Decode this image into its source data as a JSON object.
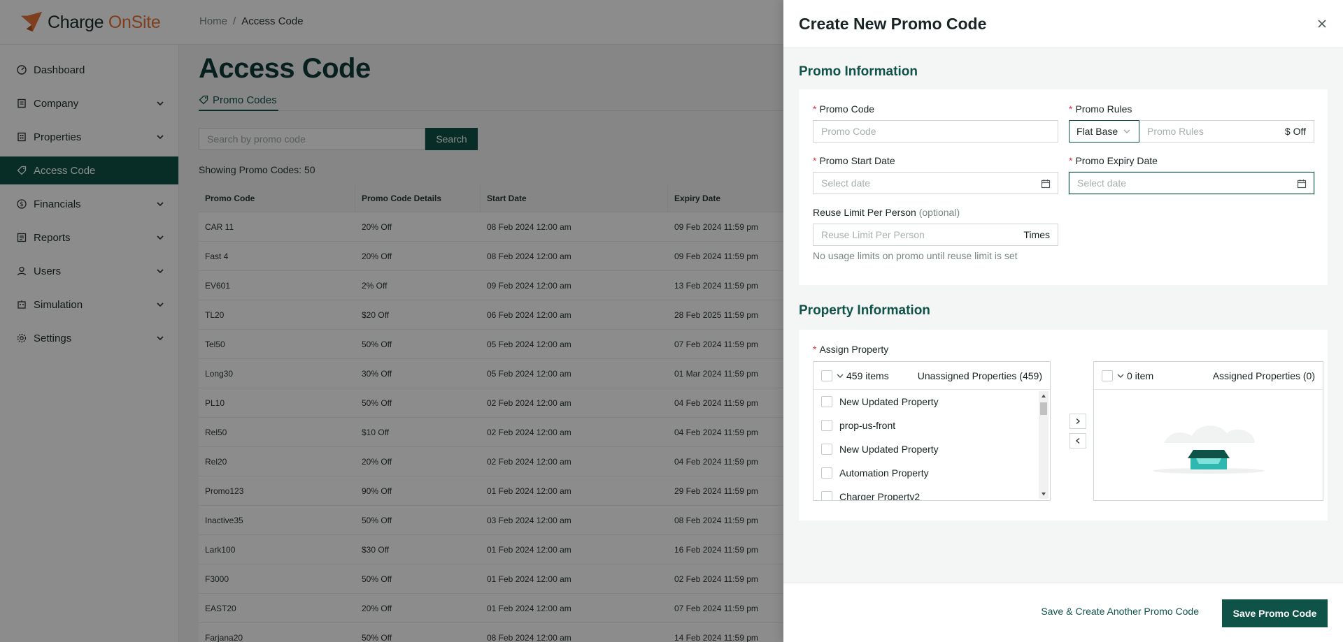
{
  "app": {
    "brand_part1": "Charge ",
    "brand_part2": "OnSite",
    "colors": {
      "primary": "#0f5248",
      "accent": "#e8733a",
      "required": "#d9363e"
    }
  },
  "breadcrumb": {
    "home": "Home",
    "separator": "/",
    "current": "Access Code"
  },
  "sidebar": {
    "items": [
      {
        "label": "Dashboard",
        "icon": "dashboard-icon",
        "expandable": false,
        "active": false
      },
      {
        "label": "Company",
        "icon": "company-icon",
        "expandable": true,
        "active": false
      },
      {
        "label": "Properties",
        "icon": "building-icon",
        "expandable": true,
        "active": false
      },
      {
        "label": "Access Code",
        "icon": "tag-icon",
        "expandable": false,
        "active": true
      },
      {
        "label": "Financials",
        "icon": "dollar-icon",
        "expandable": true,
        "active": false
      },
      {
        "label": "Reports",
        "icon": "report-icon",
        "expandable": true,
        "active": false
      },
      {
        "label": "Users",
        "icon": "user-icon",
        "expandable": true,
        "active": false
      },
      {
        "label": "Simulation",
        "icon": "simulation-icon",
        "expandable": true,
        "active": false
      },
      {
        "label": "Settings",
        "icon": "gear-icon",
        "expandable": true,
        "active": false
      }
    ]
  },
  "main": {
    "title": "Access Code",
    "tab_label": "Promo Codes",
    "search_placeholder": "Search by promo code",
    "search_button": "Search",
    "showing": "Showing Promo Codes: 50",
    "columns": [
      "Promo Code",
      "Promo Code Details",
      "Start Date",
      "Expiry Date"
    ],
    "rows": [
      [
        "CAR 11",
        "20% Off",
        "08 Feb 2024 12:00 am",
        "09 Feb 2024 11:59 pm"
      ],
      [
        "Fast 4",
        "20% Off",
        "08 Feb 2024 12:00 am",
        "09 Feb 2024 11:59 pm"
      ],
      [
        "EV601",
        "2% Off",
        "09 Feb 2024 12:00 am",
        "13 Feb 2024 11:59 pm"
      ],
      [
        "TL20",
        "$20 Off",
        "06 Feb 2024 12:00 am",
        "28 Feb 2025 11:59 pm"
      ],
      [
        "Tel50",
        "50% Off",
        "05 Feb 2024 12:00 am",
        "07 Feb 2024 11:59 pm"
      ],
      [
        "Long30",
        "30% Off",
        "05 Feb 2024 12:00 am",
        "01 Mar 2024 11:59 pm"
      ],
      [
        "PL10",
        "50% Off",
        "02 Feb 2024 12:00 am",
        "04 Feb 2024 11:59 pm"
      ],
      [
        "Rel50",
        "$10 Off",
        "02 Feb 2024 12:00 am",
        "04 Feb 2024 11:59 pm"
      ],
      [
        "Rel20",
        "20% Off",
        "02 Feb 2024 12:00 am",
        "04 Feb 2024 11:59 pm"
      ],
      [
        "Promo123",
        "90% Off",
        "01 Feb 2024 12:00 am",
        "29 Feb 2024 11:59 pm"
      ],
      [
        "Inactive35",
        "50% Off",
        "03 Feb 2024 12:00 am",
        "08 Feb 2024 11:59 pm"
      ],
      [
        "Lark100",
        "$30 Off",
        "01 Feb 2024 12:00 am",
        "16 Feb 2024 11:59 pm"
      ],
      [
        "F3000",
        "50% Off",
        "01 Feb 2024 12:00 am",
        "02 Feb 2024 11:59 pm"
      ],
      [
        "EAST20",
        "20% Off",
        "01 Feb 2024 12:00 am",
        "07 Feb 2024 11:59 pm"
      ],
      [
        "Farjana20",
        "50% Off",
        "08 Feb 2024 12:00 am",
        "14 Feb 2024 11:59 pm"
      ]
    ]
  },
  "drawer": {
    "title": "Create New Promo Code",
    "promo_section": "Promo Information",
    "promo_code_label": "Promo Code",
    "promo_code_placeholder": "Promo Code",
    "promo_rules_label": "Promo Rules",
    "promo_rules_type": "Flat Base",
    "promo_rules_placeholder": "Promo Rules",
    "promo_rules_suffix": "$ Off",
    "start_date_label": "Promo Start Date",
    "start_date_placeholder": "Select date",
    "expiry_date_label": "Promo Expiry Date",
    "expiry_date_placeholder": "Select date",
    "reuse_label": "Reuse Limit Per Person",
    "reuse_optional": "(optional)",
    "reuse_placeholder": "Reuse Limit Per Person",
    "reuse_suffix": "Times",
    "reuse_helper": "No usage limits on promo until reuse limit is set",
    "property_section": "Property Information",
    "assign_label": "Assign Property",
    "unassigned_count": "459 items",
    "unassigned_title": "Unassigned Properties (459)",
    "unassigned_items": [
      "New Updated Property",
      "prop-us-front",
      "New Updated Property",
      "Automation Property",
      "Charger Property2"
    ],
    "assigned_count": "0 item",
    "assigned_title": "Assigned Properties (0)",
    "save_another": "Save & Create Another Promo Code",
    "save": "Save Promo Code"
  }
}
